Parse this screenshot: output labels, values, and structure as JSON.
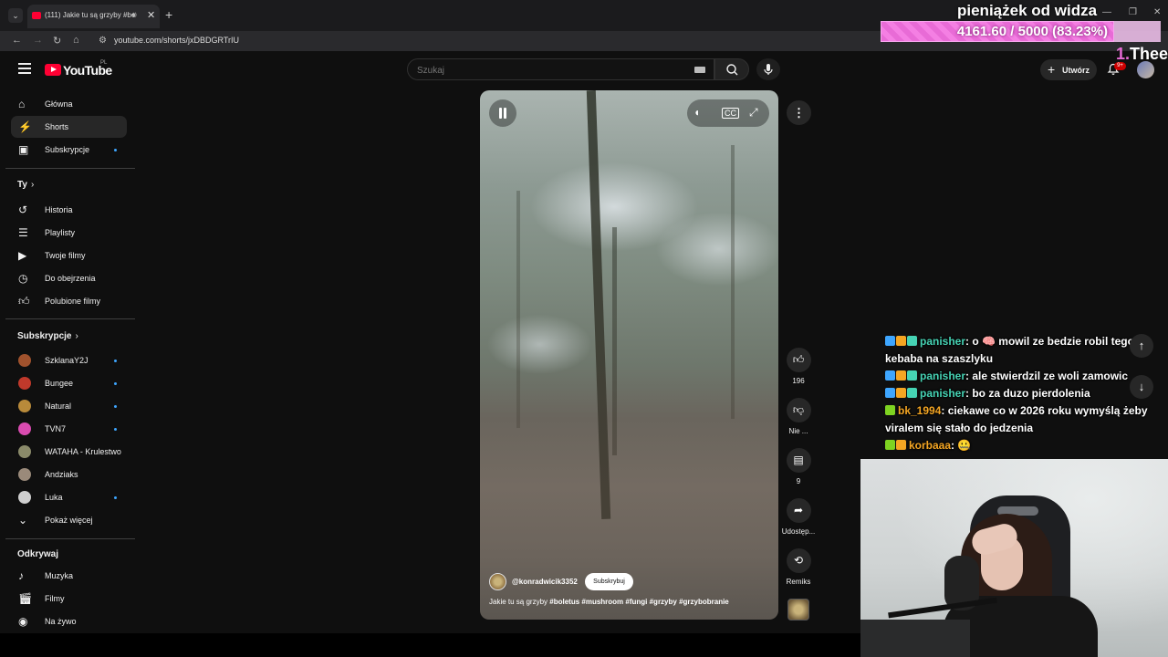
{
  "browser": {
    "tab_title": "(111) Jakie tu są grzyby #bo",
    "url": "youtube.com/shorts/jxDBDGRTrIU"
  },
  "overlay": {
    "donation_title": "pieniążek od widza",
    "donation_progress": "4161.60 / 5000 (83.23%)",
    "donation_fraction": 0.8323,
    "top_donor_rank": "1.",
    "top_donor_name": "Theel"
  },
  "header": {
    "logo_text": "YouTube",
    "logo_region": "PL",
    "search_placeholder": "Szukaj",
    "create_label": "Utwórz",
    "notifications_badge": "9+"
  },
  "sidebar": {
    "main": [
      {
        "label": "Główna",
        "icon": "home-icon"
      },
      {
        "label": "Shorts",
        "icon": "shorts-icon",
        "active": true
      },
      {
        "label": "Subskrypcje",
        "icon": "subscriptions-icon",
        "dot": true
      }
    ],
    "you_title": "Ty",
    "you": [
      {
        "label": "Historia",
        "icon": "history-icon"
      },
      {
        "label": "Playlisty",
        "icon": "playlist-icon"
      },
      {
        "label": "Twoje filmy",
        "icon": "your-videos-icon"
      },
      {
        "label": "Do obejrzenia",
        "icon": "watch-later-icon"
      },
      {
        "label": "Polubione filmy",
        "icon": "like-icon"
      }
    ],
    "subs_title": "Subskrypcje",
    "subs": [
      {
        "label": "SzklanaY2J",
        "color": "#a0522d",
        "dot": true
      },
      {
        "label": "Bungee",
        "color": "#c0392b",
        "dot": true
      },
      {
        "label": "Natural",
        "color": "#b88a3a",
        "dot": true
      },
      {
        "label": "TVN7",
        "color": "#d94bb0",
        "dot": true
      },
      {
        "label": "WATAHA - Krulestwo",
        "color": "#8a8a6a",
        "dot": false
      },
      {
        "label": "Andziaks",
        "color": "#9a8a7a",
        "dot": false
      },
      {
        "label": "Luka",
        "color": "#cfcfcf",
        "dot": true
      }
    ],
    "show_more": "Pokaż więcej",
    "explore_title": "Odkrywaj",
    "explore": [
      {
        "label": "Muzyka",
        "icon": "music-icon"
      },
      {
        "label": "Filmy",
        "icon": "film-icon"
      },
      {
        "label": "Na żywo",
        "icon": "live-icon"
      }
    ]
  },
  "short": {
    "channel": "@konradwicik3352",
    "subscribe_label": "Subskrybuj",
    "description_prefix": "Jakie tu są grzyby",
    "hashtags": "#boletus #mushroom #fungi #grzyby #grzybobranie",
    "likes": "196",
    "dislike_label": "Nie ...",
    "comments": "9",
    "share_label": "Udostęp...",
    "remix_label": "Remiks"
  },
  "chat": [
    {
      "user": "panisher",
      "user_color": "#46d3b4",
      "text": ": o 🧠 mowil ze bedzie robil tego kebaba na szaszlyku",
      "badges": [
        "#3ea6ff",
        "#f5a623",
        "#46d3b4"
      ]
    },
    {
      "user": "panisher",
      "user_color": "#46d3b4",
      "text": ": ale stwierdzil ze woli zamowic",
      "badges": [
        "#3ea6ff",
        "#f5a623",
        "#46d3b4"
      ]
    },
    {
      "user": "panisher",
      "user_color": "#46d3b4",
      "text": ": bo za duzo pierdolenia",
      "badges": [
        "#3ea6ff",
        "#f5a623",
        "#46d3b4"
      ]
    },
    {
      "user": "bk_1994",
      "user_color": "#f5a623",
      "text": ": ciekawe co w 2026 roku wymyślą żeby viralem się stało do jedzenia",
      "badges": [
        "#7ed321"
      ]
    },
    {
      "user": "korbaaa",
      "user_color": "#f5a623",
      "text": ": 🤐",
      "badges": [
        "#7ed321",
        "#f5a623"
      ]
    }
  ]
}
